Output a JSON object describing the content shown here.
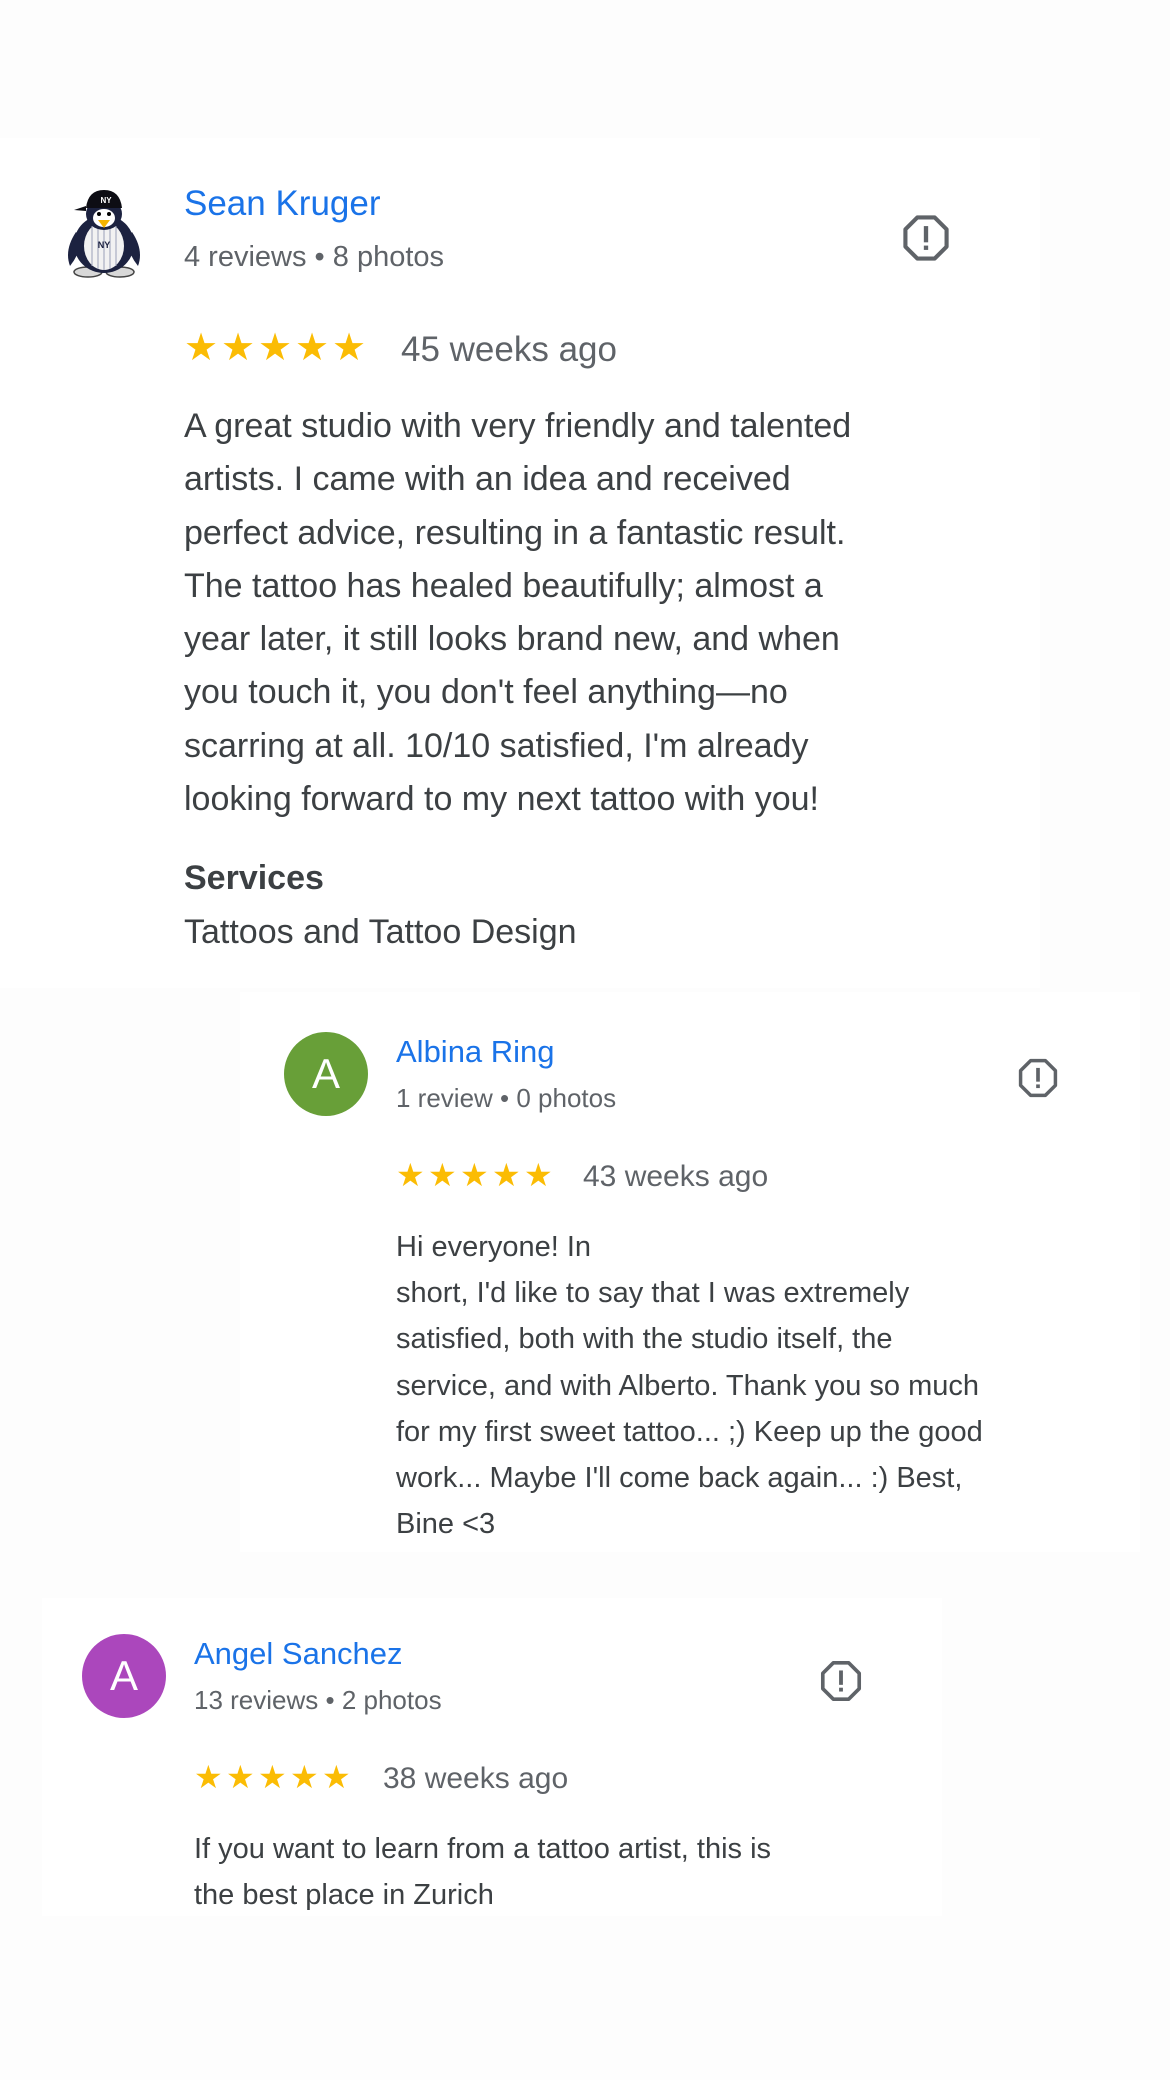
{
  "reviews": [
    {
      "author": "Sean Kruger",
      "meta": "4 reviews • 8 photos",
      "rating": 5,
      "star_glyphs": [
        "★",
        "★",
        "★",
        "★",
        "★"
      ],
      "time_ago": "45 weeks ago",
      "text": "A great studio with very friendly and talented\nartists. I came with an idea and received\nperfect advice, resulting in a fantastic result.\nThe tattoo has healed beautifully; almost a\nyear later, it still looks brand new, and when\nyou touch it, you don't feel anything—no\nscarring at all. 10/10 satisfied, I'm already\nlooking forward to my next tattoo with you!",
      "services_heading": "Services",
      "services_value": "Tattoos and Tattoo Design",
      "avatar_icon": "penguin-avatar-icon"
    },
    {
      "author": "Albina Ring",
      "avatar_letter": "A",
      "avatar_color": "#689f38",
      "meta": "1 review • 0 photos",
      "rating": 5,
      "star_glyphs": [
        "★",
        "★",
        "★",
        "★",
        "★"
      ],
      "time_ago": "43 weeks ago",
      "text": "Hi everyone! In\nshort, I'd like to say that I was extremely\nsatisfied, both with the studio itself, the\nservice, and with Alberto. Thank you so much\nfor my first sweet tattoo... ;) Keep up the good\nwork... Maybe I'll come back again... :) Best,\nBine <3"
    },
    {
      "author": "Angel Sanchez",
      "avatar_letter": "A",
      "avatar_color": "#ab47bc",
      "meta": "13 reviews • 2 photos",
      "rating": 5,
      "star_glyphs": [
        "★",
        "★",
        "★",
        "★",
        "★"
      ],
      "time_ago": "38 weeks ago",
      "text": "If you want to learn from a tattoo artist, this is\nthe best place in Zurich"
    }
  ],
  "icons": {
    "report": "report-flag-icon",
    "star": "star-icon"
  },
  "colors": {
    "link": "#1a73e8",
    "star": "#fbbc04",
    "muted": "#5f6368",
    "text": "#3c4043"
  }
}
